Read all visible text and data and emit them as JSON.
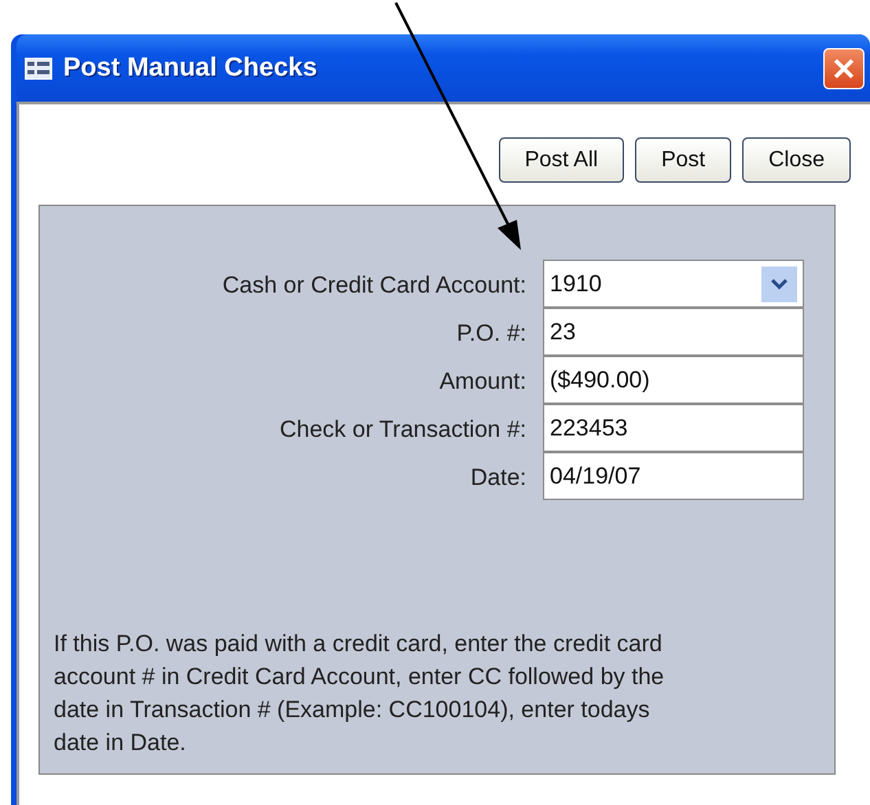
{
  "window": {
    "title": "Post Manual Checks"
  },
  "buttons": [
    "Post All",
    "Post",
    "Close"
  ],
  "fields": [
    {
      "label": "Cash or Credit Card Account:",
      "value": "1910",
      "kind": "combo"
    },
    {
      "label": "P.O. #:",
      "value": "23",
      "kind": "text"
    },
    {
      "label": "Amount:",
      "value": "($490.00)",
      "kind": "text"
    },
    {
      "label": "Check or Transaction #:",
      "value": "223453",
      "kind": "text"
    },
    {
      "label": "Date:",
      "value": "04/19/07",
      "kind": "text"
    }
  ],
  "note": "If this P.O. was paid with a credit card, enter the credit card account # in Credit Card Account, enter CC followed by the date in Transaction # (Example: CC100104), enter todays date in Date."
}
